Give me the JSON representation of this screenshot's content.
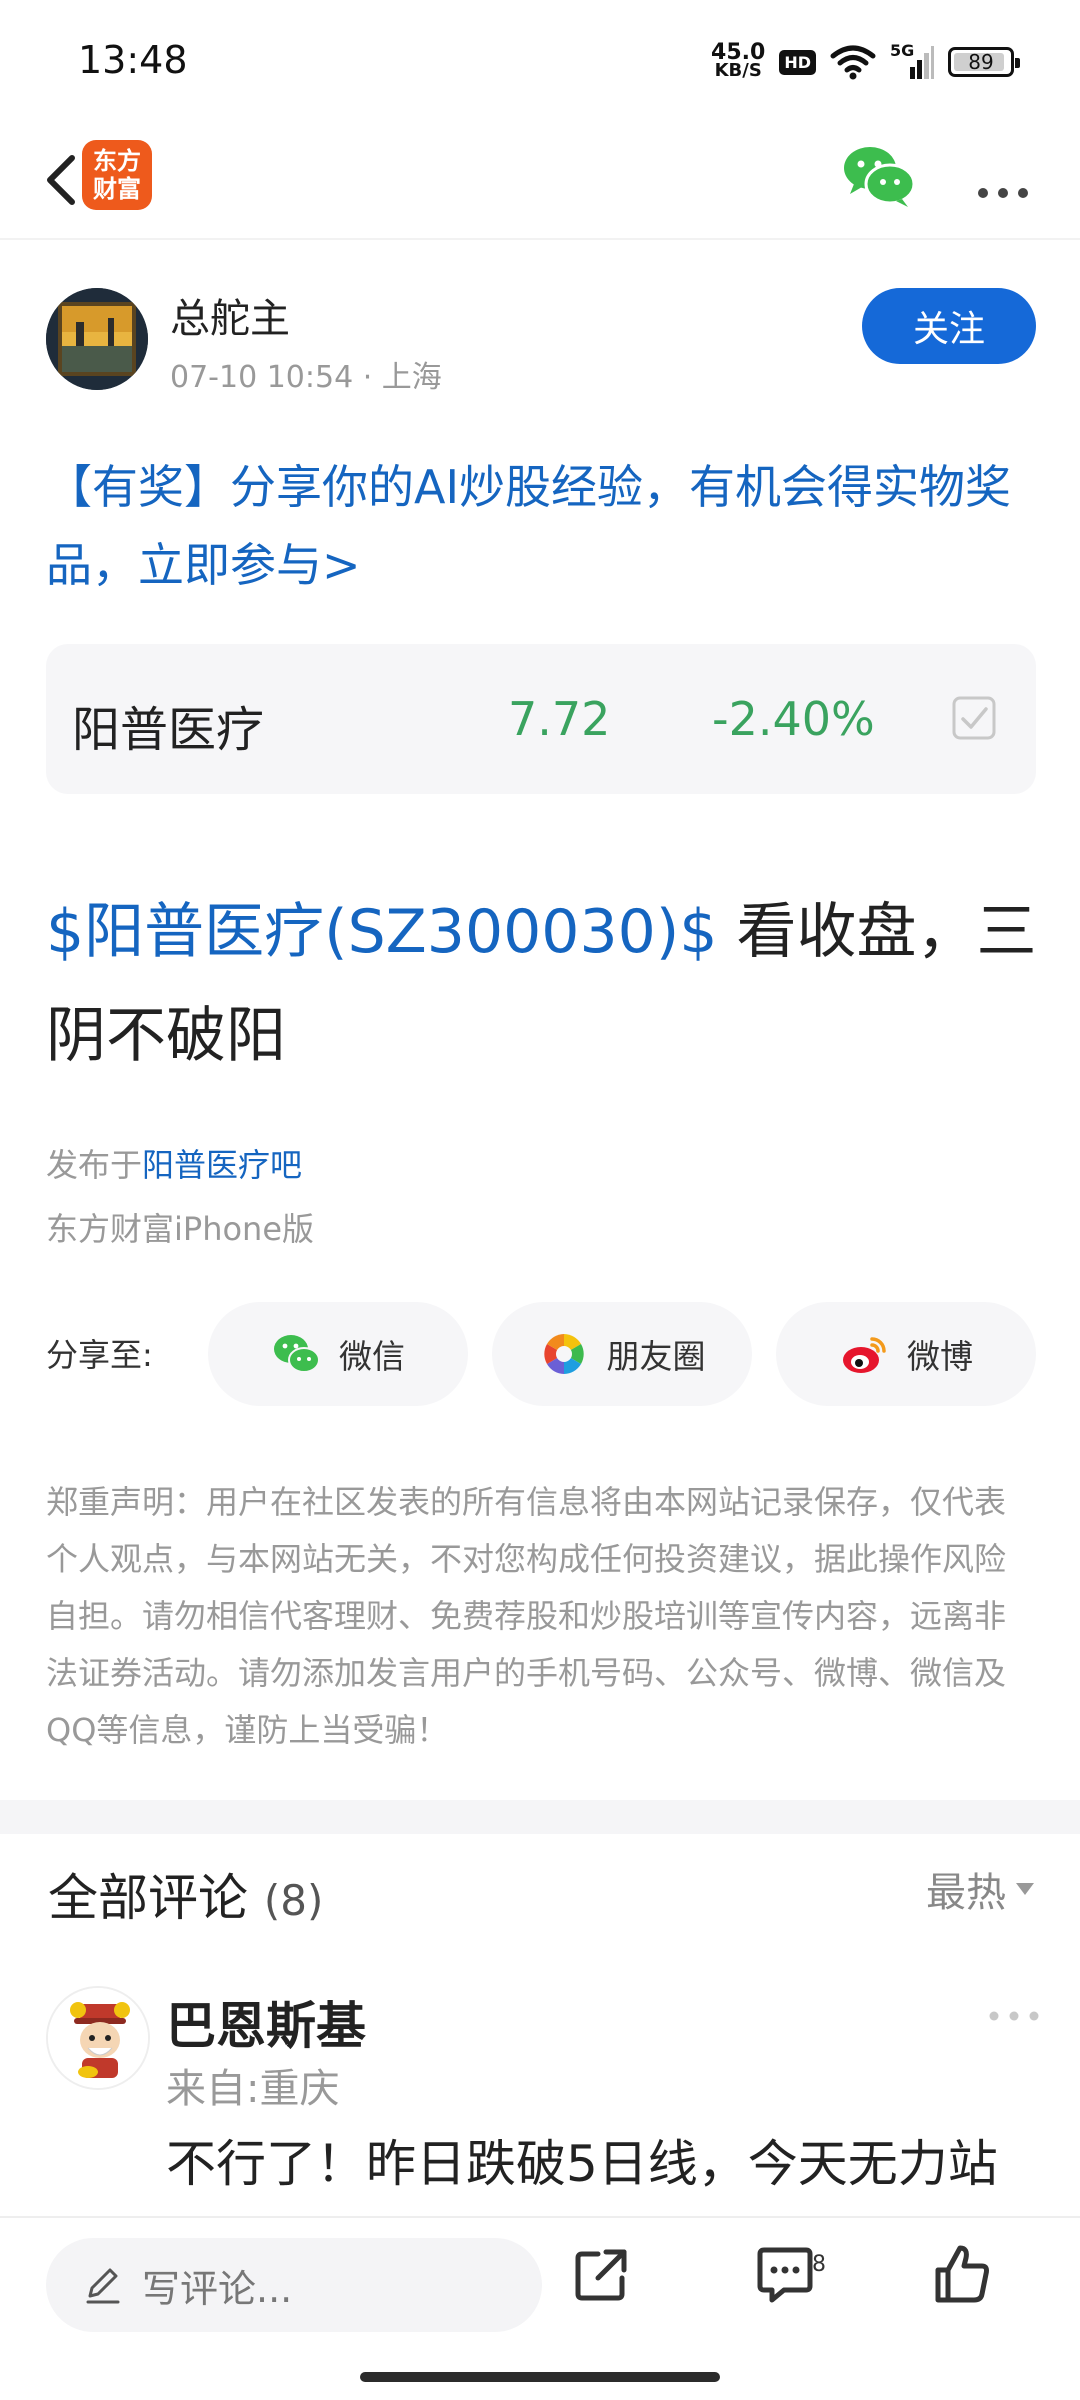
{
  "status_bar": {
    "time": "13:48",
    "net_speed": "45.0",
    "net_unit": "KB/S",
    "hd": "HD",
    "signal": "5G",
    "battery": "89"
  },
  "nav": {
    "logo_line1": "东方",
    "logo_line2": "财富"
  },
  "author": {
    "name": "总舵主",
    "meta": "07-10 10:54 · 上海",
    "follow_label": "关注"
  },
  "promo": "【有奖】分享你的AI炒股经验，有机会得实物奖品，立即参与>",
  "stock": {
    "name": "阳普医疗",
    "price": "7.72",
    "change": "-2.40%",
    "color": "#3aa35f"
  },
  "post": {
    "tag": "$阳普医疗(SZ300030)$",
    "text": " 看收盘，三阴不破阳",
    "posted_in_prefix": "发布于",
    "posted_in_link": "阳普医疗吧",
    "client": "东方财富iPhone版"
  },
  "share": {
    "label": "分享至:",
    "wechat": "微信",
    "moments": "朋友圈",
    "weibo": "微博"
  },
  "disclaimer": "郑重声明：用户在社区发表的所有信息将由本网站记录保存，仅代表个人观点，与本网站无关，不对您构成任何投资建议，据此操作风险自担。请勿相信代客理财、免费荐股和炒股培训等宣传内容，远离非法证券活动。请勿添加发言用户的手机号码、公众号、微博、微信及QQ等信息，谨防上当受骗！",
  "comments": {
    "title": "全部评论",
    "count": "(8)",
    "sort": "最热",
    "items": [
      {
        "name": "巴恩斯基",
        "location": "来自:重庆",
        "text": "不行了！昨日跌破5日线，今天无力站"
      }
    ]
  },
  "bottom_bar": {
    "input_placeholder": "写评论...",
    "comment_badge": "8"
  },
  "colors": {
    "brand_blue": "#1565c0",
    "follow_blue": "#1569d8",
    "logo_orange": "#ee5a1c",
    "stock_green": "#3aa35f"
  }
}
